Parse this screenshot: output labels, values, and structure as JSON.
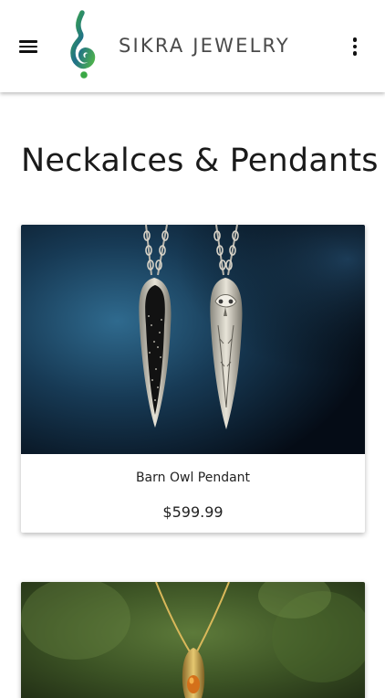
{
  "header": {
    "brand_name": "SIKRA JEWELRY",
    "menu_icon": "hamburger-menu-icon",
    "overflow_icon": "more-vertical-icon",
    "logo_icon": "spiral-hook-logo-icon"
  },
  "page": {
    "title": "Neckalces & Pendants"
  },
  "products": [
    {
      "name": "Barn Owl Pendant",
      "price": "$599.99",
      "image": "two-silver-pendants-image"
    },
    {
      "name": "",
      "price": "",
      "image": "gold-amber-pendant-image"
    }
  ],
  "colors": {
    "background": "#ffffff",
    "text": "#111111",
    "brand_text": "#4a4a4a",
    "logo_green": "#2e8b57",
    "logo_teal": "#1f6f8b"
  }
}
